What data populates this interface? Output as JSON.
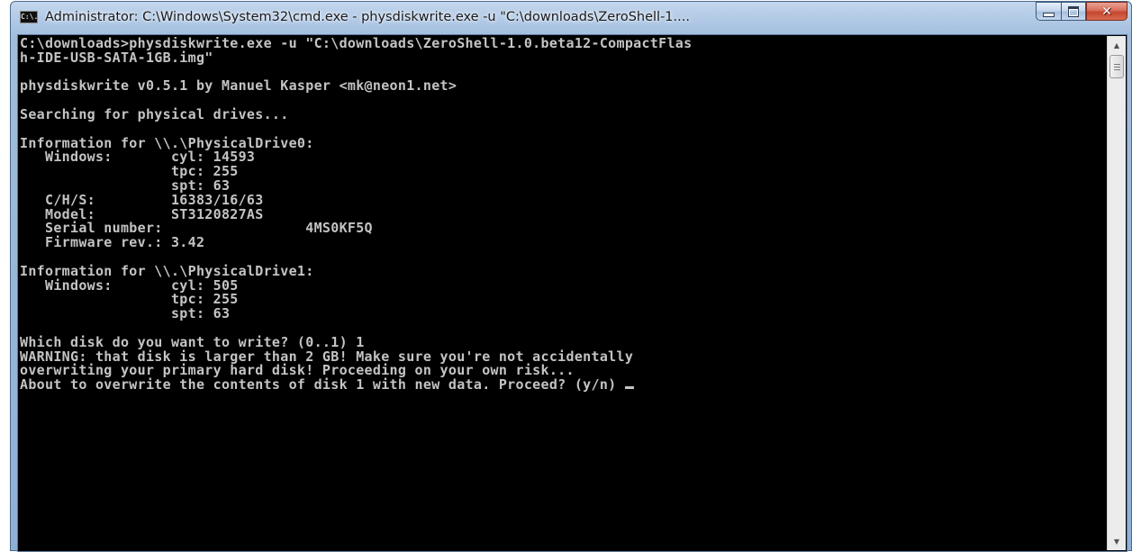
{
  "window": {
    "title": "Administrator: C:\\Windows\\System32\\cmd.exe - physdiskwrite.exe  -u \"C:\\downloads\\ZeroShell-1....",
    "icon": "cmd-icon",
    "icon_label": "C:\\."
  },
  "caption_buttons": {
    "minimize": "minimize-icon",
    "maximize": "maximize-icon",
    "close": "✕"
  },
  "console": {
    "lines": [
      "C:\\downloads>physdiskwrite.exe -u \"C:\\downloads\\ZeroShell-1.0.beta12-CompactFlas",
      "h-IDE-USB-SATA-1GB.img\"",
      "",
      "physdiskwrite v0.5.1 by Manuel Kasper <mk@neon1.net>",
      "",
      "Searching for physical drives...",
      "",
      "Information for \\\\.\\PhysicalDrive0:",
      "   Windows:       cyl: 14593",
      "                  tpc: 255",
      "                  spt: 63",
      "   C/H/S:         16383/16/63",
      "   Model:         ST3120827AS",
      "   Serial number:                 4MS0KF5Q",
      "   Firmware rev.: 3.42",
      "",
      "Information for \\\\.\\PhysicalDrive1:",
      "   Windows:       cyl: 505",
      "                  tpc: 255",
      "                  spt: 63",
      "",
      "Which disk do you want to write? (0..1) 1",
      "WARNING: that disk is larger than 2 GB! Make sure you're not accidentally",
      "overwriting your primary hard disk! Proceeding on your own risk...",
      "About to overwrite the contents of disk 1 with new data. Proceed? (y/n) "
    ]
  },
  "scrollbar": {
    "up_arrow": "▲",
    "down_arrow": "▼"
  },
  "colors": {
    "console_bg": "#000000",
    "console_text": "#c4c4c4",
    "title_bar": "#a9c3e2",
    "close_button": "#c4462e"
  }
}
